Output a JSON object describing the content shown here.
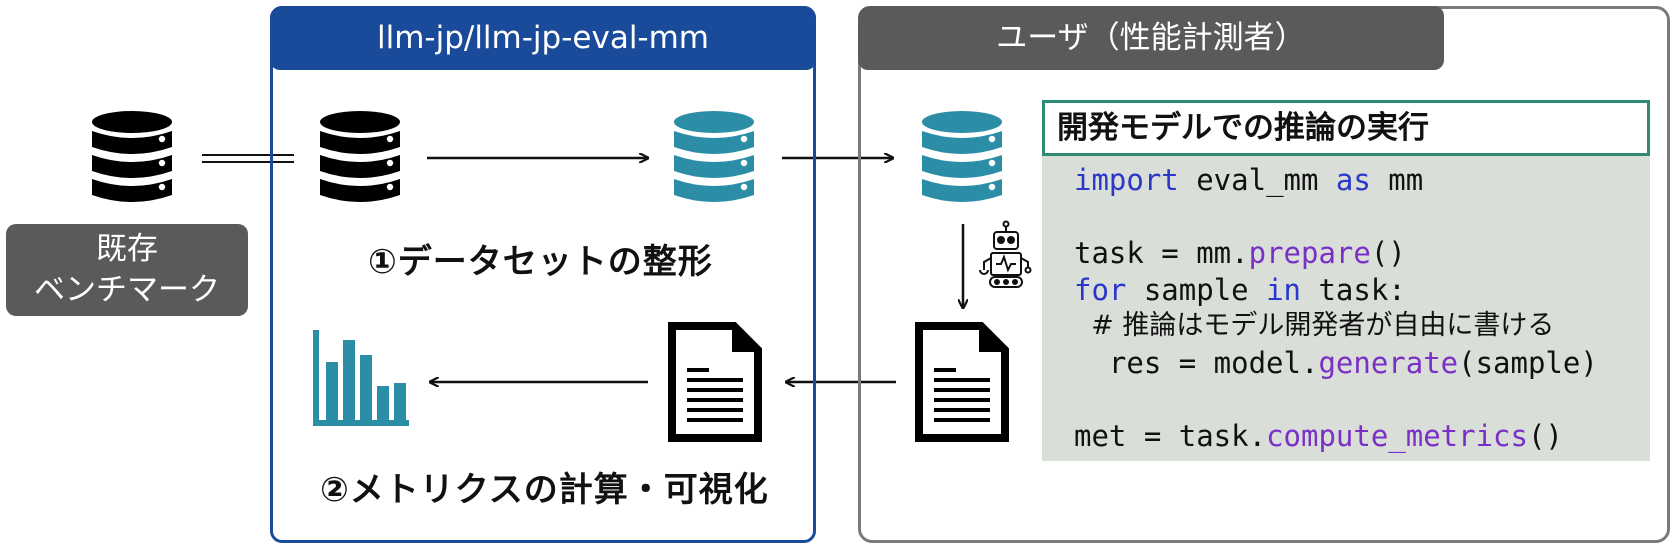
{
  "colors": {
    "blue_panel": "#1a4a9a",
    "gray_panel": "#5a5a5a",
    "teal": "#2b8ea6",
    "code_bg": "#d9ded8",
    "title_border": "#2e8b74"
  },
  "benchmark": {
    "line1": "既存",
    "line2": "ベンチマーク",
    "icon": "database-icon"
  },
  "repo_panel": {
    "title": "llm-jp/llm-jp-eval-mm",
    "step1": "①データセットの整形",
    "step2": "②メトリクスの計算・可視化"
  },
  "user_panel": {
    "title": "ユーザ（性能計測者）",
    "code_title": "開発モデルでの推論の実行",
    "code": {
      "l1": {
        "kw1": "import",
        "t1": " eval_mm ",
        "kw2": "as",
        "t2": " mm"
      },
      "l3": {
        "t1": "task = mm.",
        "fn": "prepare",
        "t2": "()"
      },
      "l4": {
        "kw1": "for",
        "t1": " sample ",
        "kw2": "in",
        "t2": " task:"
      },
      "l5": "  # 推論はモデル開発者が自由に書ける",
      "l6": {
        "t1": "  res = model.",
        "fn": "generate",
        "t2": "(sample)"
      },
      "l8": {
        "t1": "met = task.",
        "fn": "compute_metrics",
        "t2": "()"
      }
    }
  }
}
